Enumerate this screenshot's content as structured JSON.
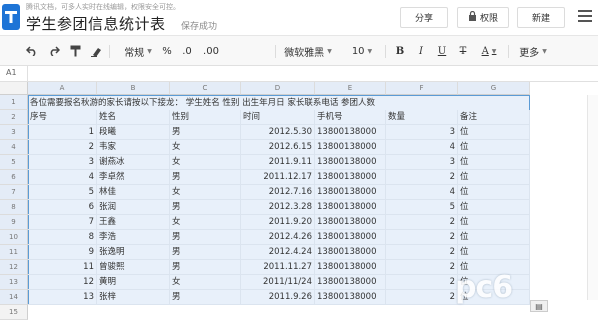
{
  "header": {
    "notice": "腾讯文档，可多人实时在线编辑，权限安全可控。",
    "title": "学生参团信息统计表",
    "save_status": "保存成功",
    "share_label": "分享",
    "permission_label": "权限",
    "new_label": "新建"
  },
  "toolbar": {
    "style_label": "常规",
    "percent": "%",
    "decimal_dec": ".0",
    "decimal_inc": ".00",
    "font_label": "微软雅黑",
    "font_size": "10",
    "bold": "B",
    "italic": "I",
    "underline": "U",
    "strike": "T",
    "font_color": "A",
    "more_label": "更多"
  },
  "formula_bar": {
    "cell_ref": "A1"
  },
  "columns": [
    "A",
    "B",
    "C",
    "D",
    "E",
    "F",
    "G"
  ],
  "row_numbers": [
    "1",
    "2",
    "3",
    "4",
    "5",
    "6",
    "7",
    "8",
    "9",
    "10",
    "11",
    "12",
    "13",
    "14",
    "15"
  ],
  "row1_text": "各位需要报名秋游的家长请按以下接龙：",
  "row1_faded": "学生姓名 性别 出生年月日 家长联系电话 参团人数",
  "table": {
    "headers": [
      "序号",
      "姓名",
      "性别",
      "时间",
      "手机号",
      "数量",
      "备注"
    ],
    "rows": [
      [
        "1",
        "段曦",
        "男",
        "2012.5.30",
        "13800138000",
        "3",
        "位"
      ],
      [
        "2",
        "韦家",
        "女",
        "2012.6.15",
        "13800138000",
        "4",
        "位"
      ],
      [
        "3",
        "谢燕冰",
        "女",
        "2011.9.11",
        "13800138000",
        "3",
        "位"
      ],
      [
        "4",
        "李卓然",
        "男",
        "2011.12.17",
        "13800138000",
        "2",
        "位"
      ],
      [
        "5",
        "林佳",
        "女",
        "2012.7.16",
        "13800138000",
        "4",
        "位"
      ],
      [
        "6",
        "张润",
        "男",
        "2012.3.28",
        "13800138000",
        "5",
        "位"
      ],
      [
        "7",
        "王鑫",
        "女",
        "2011.9.20",
        "13800138000",
        "2",
        "位"
      ],
      [
        "8",
        "李浩",
        "男",
        "2012.4.26",
        "13800138000",
        "2",
        "位"
      ],
      [
        "9",
        "张逸明",
        "男",
        "2012.4.24",
        "13800138000",
        "2",
        "位"
      ],
      [
        "11",
        "曾骏熙",
        "男",
        "2011.11.27",
        "13800138000",
        "2",
        "位"
      ],
      [
        "12",
        "黄明",
        "女",
        "2011/11/24",
        "13800138000",
        "2",
        "位"
      ],
      [
        "13",
        "张梓",
        "男",
        "2011.9.26",
        "13800138000",
        "2",
        "位"
      ]
    ]
  },
  "watermark": "pc6"
}
